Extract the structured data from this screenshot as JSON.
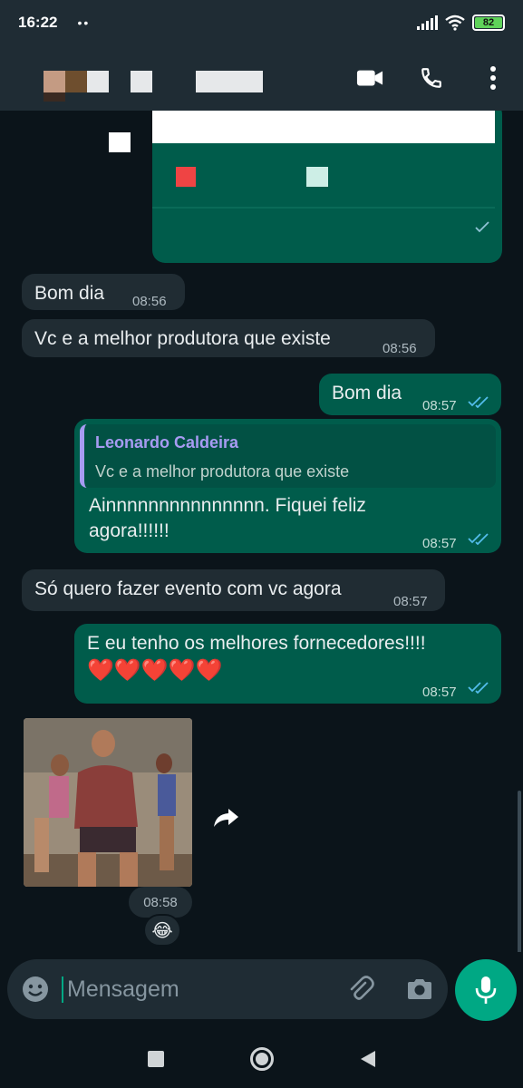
{
  "status_bar": {
    "time": "16:22",
    "dots": "••",
    "battery": "82",
    "icons": [
      "signal-icon",
      "wifi-icon",
      "battery-icon"
    ]
  },
  "header": {
    "contact_name_redacted": true,
    "icons": [
      "video-call-icon",
      "phone-icon",
      "more-options-icon"
    ]
  },
  "messages": [
    {
      "direction": "out",
      "type": "image-redacted",
      "status": "sent"
    },
    {
      "direction": "in",
      "text": "Bom dia",
      "time": "08:56"
    },
    {
      "direction": "in",
      "text": "Vc e a melhor produtora que existe",
      "time": "08:56"
    },
    {
      "direction": "out",
      "text": "Bom dia",
      "time": "08:57",
      "status": "read"
    },
    {
      "direction": "out",
      "reply_to": {
        "author": "Leonardo Caldeira",
        "text": "Vc e a melhor produtora que existe"
      },
      "text_line1": "Ainnnnnnnnnnnnnnn. Fiquei feliz",
      "text_line2": "agora!!!!!!",
      "time": "08:57",
      "status": "read"
    },
    {
      "direction": "in",
      "text": "Só quero fazer evento com vc agora",
      "time": "08:57"
    },
    {
      "direction": "out",
      "text": "E eu tenho os melhores fornecedores!!!!",
      "emojis": "❤️❤️❤️❤️❤️",
      "time": "08:57",
      "status": "read"
    },
    {
      "direction": "in",
      "type": "gif",
      "time": "08:58",
      "reaction": "😂"
    }
  ],
  "composer": {
    "placeholder": "Mensagem",
    "icons": [
      "emoji-icon",
      "attach-icon",
      "camera-icon",
      "mic-icon"
    ]
  },
  "nav": {
    "icons": [
      "recents-icon",
      "home-icon",
      "back-icon"
    ]
  },
  "colors": {
    "background": "#0b141a",
    "incoming_bubble": "#202c33",
    "outgoing_bubble": "#005c4b",
    "accent": "#00a884",
    "read_ticks": "#53bdeb",
    "quote_author": "#a79bf2"
  }
}
